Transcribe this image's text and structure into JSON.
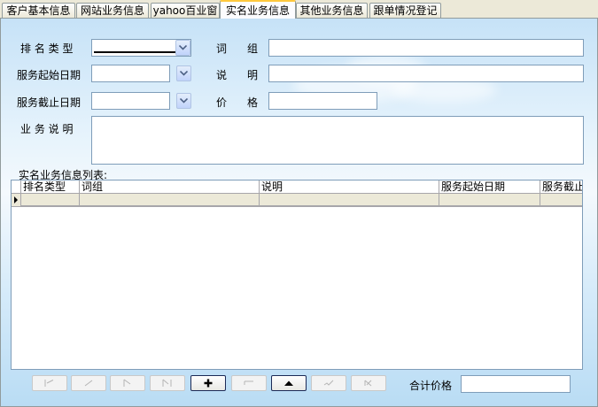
{
  "tabs": [
    {
      "label": "客户基本信息"
    },
    {
      "label": "网站业务信息"
    },
    {
      "label": "yahoo百业窗"
    },
    {
      "label": "实名业务信息"
    },
    {
      "label": "其他业务信息"
    },
    {
      "label": "跟单情况登记"
    }
  ],
  "active_tab": 3,
  "form": {
    "rank_type_label": "排 名 类 型",
    "phrase_label": "词      组",
    "start_date_label": "服务起始日期",
    "description_label": "说      明",
    "end_date_label": "服务截止日期",
    "price_label": "价      格",
    "business_desc_label": "业 务 说 明",
    "rank_type_value": "",
    "phrase_value": "",
    "start_date_value": "",
    "description_value": "",
    "end_date_value": "",
    "price_value": "",
    "business_desc_value": ""
  },
  "list": {
    "title": "实名业务信息列表:",
    "columns": [
      "排名类型",
      "词组",
      "说明",
      "服务起始日期",
      "服务截止"
    ],
    "rows": [
      [
        "",
        "",
        "",
        "",
        ""
      ]
    ]
  },
  "navigator": {
    "buttons": [
      {
        "name": "first",
        "icon": "first-record-icon",
        "enabled": false
      },
      {
        "name": "prior",
        "icon": "prior-record-icon",
        "enabled": false
      },
      {
        "name": "next",
        "icon": "next-record-icon",
        "enabled": false
      },
      {
        "name": "last",
        "icon": "last-record-icon",
        "enabled": false
      },
      {
        "name": "insert",
        "icon": "plus-icon",
        "enabled": true
      },
      {
        "name": "delete",
        "icon": "minus-icon",
        "enabled": false
      },
      {
        "name": "edit",
        "icon": "up-triangle-icon",
        "enabled": true
      },
      {
        "name": "post",
        "icon": "check-icon",
        "enabled": false
      },
      {
        "name": "cancel",
        "icon": "x-icon",
        "enabled": false
      }
    ],
    "total_price_label": "合计价格",
    "total_price_value": ""
  }
}
